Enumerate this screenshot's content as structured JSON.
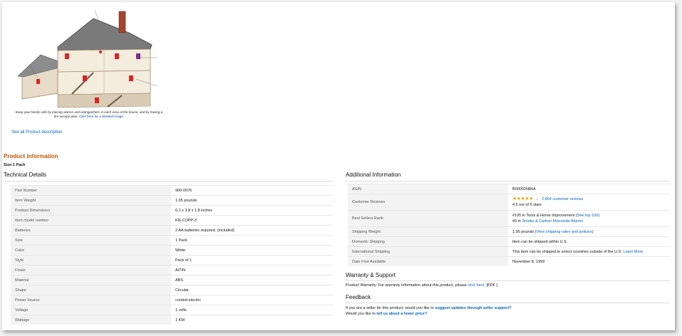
{
  "house_caption": {
    "text": "Keep your family safe by placing alarms and extinguishers in each area of the house, and by having a fire escape plan.",
    "link": "Click here for a detailed image."
  },
  "see_all": "See all Product description",
  "product_info_title": "Product information",
  "size": {
    "label": "Size:",
    "value": "1 Pack"
  },
  "technical": {
    "title": "Technical Details",
    "rows": [
      {
        "label": "Part Number",
        "value": "900-0076"
      },
      {
        "label": "Item Weight",
        "value": "1.05 pounds"
      },
      {
        "label": "Product Dimensions",
        "value": "6.1 x 3.8 x 1.8 inches"
      },
      {
        "label": "Item model number",
        "value": "KN-COPP-3"
      },
      {
        "label": "Batteries",
        "value": "2 AA batteries required. (included)"
      },
      {
        "label": "Size",
        "value": "1 Pack"
      },
      {
        "label": "Color",
        "value": "White"
      },
      {
        "label": "Style",
        "value": "Pack of 1"
      },
      {
        "label": "Finish",
        "value": "AITIN"
      },
      {
        "label": "Material",
        "value": "ABS"
      },
      {
        "label": "Shape",
        "value": "Circular"
      },
      {
        "label": "Power Source",
        "value": "corded-electric"
      },
      {
        "label": "Voltage",
        "value": "1 volts"
      },
      {
        "label": "Wattage",
        "value": "1 KW"
      }
    ]
  },
  "additional": {
    "title": "Additional Information",
    "asin": {
      "label": "ASIN",
      "value": "B00002N86A"
    },
    "reviews": {
      "label": "Customer Reviews",
      "stars": "★★★★★",
      "count": "2,864 customer reviews",
      "rating": "4.5 out of 5 stars",
      "rating_value": 4.5
    },
    "rank": {
      "label": "Best Sellers Rank",
      "line1_text": "#105 in Tools & Home Improvement (",
      "line1_link": "See top 100",
      "line1_end": ")",
      "line2_text": "#5 in ",
      "line2_link": "Smoke & Carbon Monoxide Alarms"
    },
    "shipping_weight": {
      "label": "Shipping Weight",
      "text": "1.05 pounds (",
      "link": "View shipping rates and policies",
      "end": ")"
    },
    "domestic": {
      "label": "Domestic Shipping",
      "value": "Item can be shipped within U.S."
    },
    "international": {
      "label": "International Shipping",
      "text": "This item can be shipped to select countries outside of the U.S. ",
      "link": "Learn More"
    },
    "date_first": {
      "label": "Date First Available",
      "value": "November 8, 1999"
    }
  },
  "warranty": {
    "title": "Warranty & Support",
    "text": "Product Warranty: For warranty information about this product, please ",
    "link": "click here.",
    "suffix": " [PDF ]"
  },
  "feedback": {
    "title": "Feedback",
    "line1_text": "If you are a seller for this product, would you like to ",
    "line1_link": "suggest updates through seller support?",
    "line2_text": "Would you like to ",
    "line2_link": "tell us about a lower price?"
  }
}
